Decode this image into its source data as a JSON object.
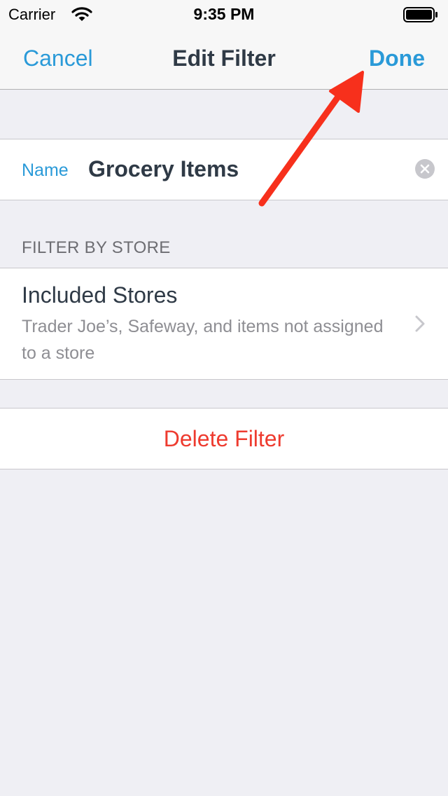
{
  "status_bar": {
    "carrier": "Carrier",
    "time": "9:35 PM",
    "icons": [
      "wifi-icon",
      "battery-icon"
    ]
  },
  "nav_bar": {
    "cancel_label": "Cancel",
    "title": "Edit Filter",
    "done_label": "Done"
  },
  "name_field": {
    "label": "Name",
    "value": "Grocery Items",
    "clear_icon": "clear-circle-icon"
  },
  "filter_section": {
    "header": "FILTER BY STORE",
    "included_stores": {
      "title": "Included Stores",
      "detail": "Trader Joe’s, Safeway, and items not assigned to a store",
      "accessory_icon": "chevron-right-icon"
    }
  },
  "delete_filter": {
    "label": "Delete Filter"
  },
  "annotation": {
    "type": "arrow-icon",
    "points_to": "done-button"
  },
  "colors": {
    "tint": "#2a9ad8",
    "destructive": "#ee3b2f",
    "primary_text": "#2f3a46",
    "secondary_text": "#8e8e93",
    "background": "#efeff4",
    "arrow": "#f7301c"
  }
}
